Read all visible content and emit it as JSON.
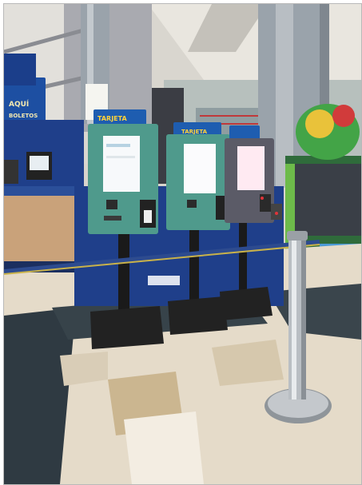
{
  "photo": {
    "subject": "self-service ticket kiosks in a cinema lobby",
    "kiosk_header_label": "TARJETA",
    "wall_sign": {
      "line1": "AQUÍ",
      "line2": "BOLETOS"
    },
    "colors": {
      "kiosk_green": "#4f9a8c",
      "kiosk_dark": "#5b5b67",
      "counter_blue": "#1f3f8a",
      "rope_blue": "#2d4b8f",
      "rope_yellow": "#c9b24a",
      "floor_light": "#e7dccb",
      "floor_dark": "#2f3a42",
      "pillar_grey": "#9aa3ab"
    }
  }
}
